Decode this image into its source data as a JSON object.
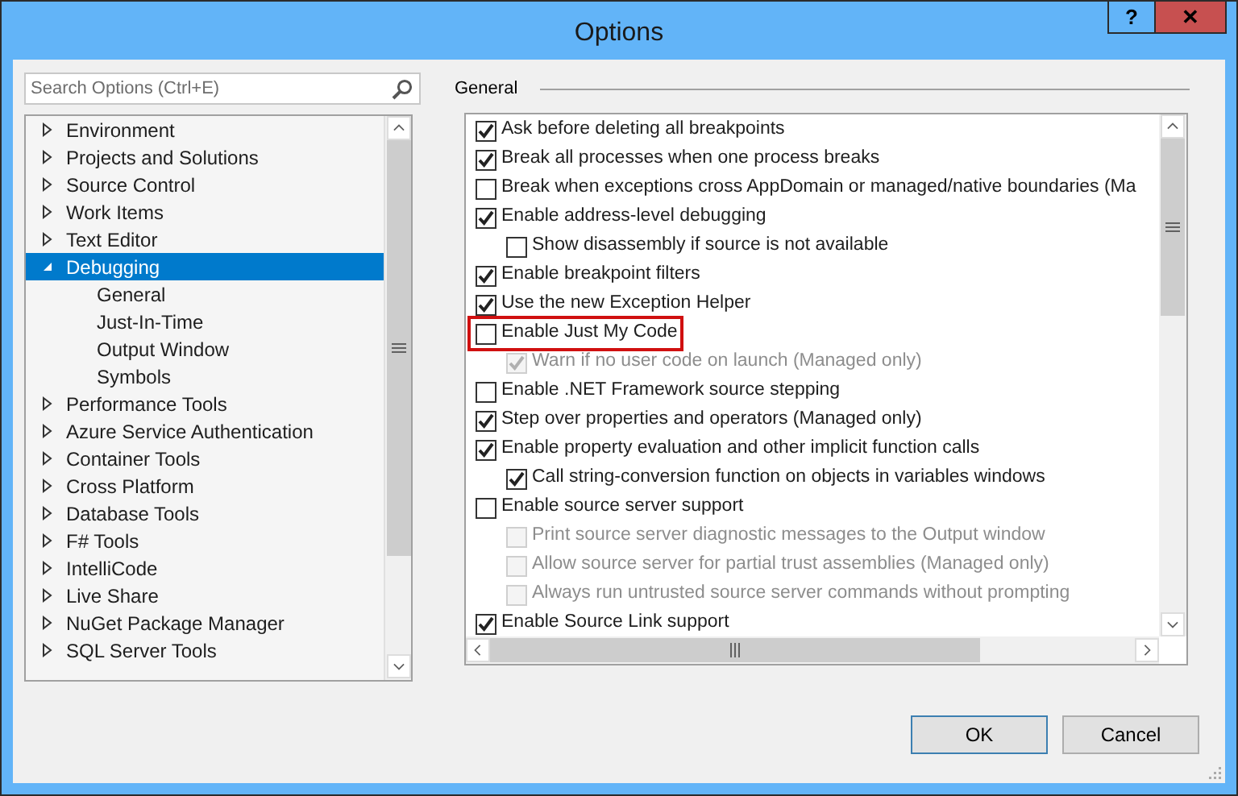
{
  "window": {
    "title": "Options",
    "help_button": "?",
    "close_button": "✕"
  },
  "search": {
    "placeholder": "Search Options (Ctrl+E)"
  },
  "tree": [
    {
      "label": "Environment",
      "expanded": false,
      "selected": false
    },
    {
      "label": "Projects and Solutions",
      "expanded": false,
      "selected": false
    },
    {
      "label": "Source Control",
      "expanded": false,
      "selected": false
    },
    {
      "label": "Work Items",
      "expanded": false,
      "selected": false
    },
    {
      "label": "Text Editor",
      "expanded": false,
      "selected": false
    },
    {
      "label": "Debugging",
      "expanded": true,
      "selected": true,
      "children": [
        {
          "label": "General",
          "selected": false
        },
        {
          "label": "Just-In-Time",
          "selected": false
        },
        {
          "label": "Output Window",
          "selected": false
        },
        {
          "label": "Symbols",
          "selected": false
        }
      ]
    },
    {
      "label": "Performance Tools",
      "expanded": false,
      "selected": false
    },
    {
      "label": "Azure Service Authentication",
      "expanded": false,
      "selected": false
    },
    {
      "label": "Container Tools",
      "expanded": false,
      "selected": false
    },
    {
      "label": "Cross Platform",
      "expanded": false,
      "selected": false
    },
    {
      "label": "Database Tools",
      "expanded": false,
      "selected": false
    },
    {
      "label": "F# Tools",
      "expanded": false,
      "selected": false
    },
    {
      "label": "IntelliCode",
      "expanded": false,
      "selected": false
    },
    {
      "label": "Live Share",
      "expanded": false,
      "selected": false
    },
    {
      "label": "NuGet Package Manager",
      "expanded": false,
      "selected": false
    },
    {
      "label": "SQL Server Tools",
      "expanded": false,
      "selected": false
    }
  ],
  "section": {
    "title": "General"
  },
  "options": [
    {
      "label": "Ask before deleting all breakpoints",
      "checked": true,
      "disabled": false,
      "highlighted": false
    },
    {
      "label": "Break all processes when one process breaks",
      "checked": true,
      "disabled": false,
      "highlighted": false
    },
    {
      "label": "Break when exceptions cross AppDomain or managed/native boundaries (Ma",
      "checked": false,
      "disabled": false,
      "highlighted": false
    },
    {
      "label": "Enable address-level debugging",
      "checked": true,
      "disabled": false,
      "highlighted": false,
      "children": [
        {
          "label": "Show disassembly if source is not available",
          "checked": false,
          "disabled": false
        }
      ]
    },
    {
      "label": "Enable breakpoint filters",
      "checked": true,
      "disabled": false,
      "highlighted": false
    },
    {
      "label": "Use the new Exception Helper",
      "checked": true,
      "disabled": false,
      "highlighted": false
    },
    {
      "label": "Enable Just My Code",
      "checked": false,
      "disabled": false,
      "highlighted": true,
      "children": [
        {
          "label": "Warn if no user code on launch (Managed only)",
          "checked": true,
          "disabled": true
        }
      ]
    },
    {
      "label": "Enable .NET Framework source stepping",
      "checked": false,
      "disabled": false,
      "highlighted": false
    },
    {
      "label": "Step over properties and operators (Managed only)",
      "checked": true,
      "disabled": false,
      "highlighted": false
    },
    {
      "label": "Enable property evaluation and other implicit function calls",
      "checked": true,
      "disabled": false,
      "highlighted": false,
      "children": [
        {
          "label": "Call string-conversion function on objects in variables windows",
          "checked": true,
          "disabled": false
        }
      ]
    },
    {
      "label": "Enable source server support",
      "checked": false,
      "disabled": false,
      "highlighted": false,
      "children": [
        {
          "label": "Print source server diagnostic messages to the Output window",
          "checked": false,
          "disabled": true
        },
        {
          "label": "Allow source server for partial trust assemblies (Managed only)",
          "checked": false,
          "disabled": true
        },
        {
          "label": "Always run untrusted source server commands without prompting",
          "checked": false,
          "disabled": true
        }
      ]
    },
    {
      "label": "Enable Source Link support",
      "checked": true,
      "disabled": false,
      "highlighted": false
    }
  ],
  "buttons": [
    {
      "label": "OK",
      "default": true
    },
    {
      "label": "Cancel",
      "default": false
    }
  ]
}
